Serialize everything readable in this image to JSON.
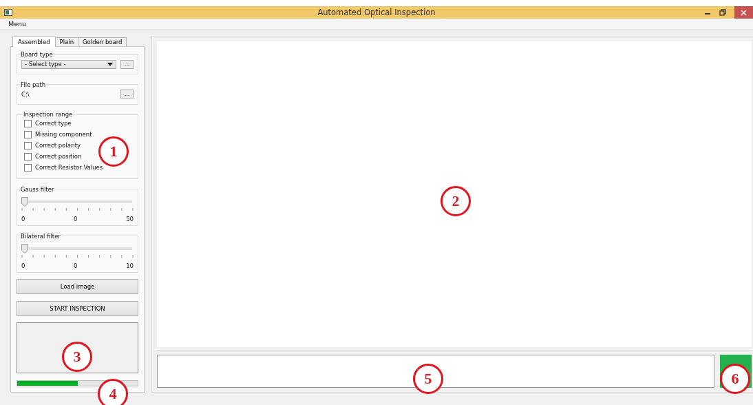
{
  "window": {
    "title": "Automated Optical Inspection"
  },
  "menu": [
    "Menu"
  ],
  "tabs": [
    {
      "label": "Assembled",
      "selected": true
    },
    {
      "label": "Plain",
      "selected": false
    },
    {
      "label": "Golden board",
      "selected": false
    }
  ],
  "board_type": {
    "title": "Board type",
    "value": "- Select type -",
    "browse": "..."
  },
  "file_path": {
    "title": "File path",
    "value": "C:\\",
    "browse": "..."
  },
  "inspection_range": {
    "title": "Inspection range",
    "options": [
      {
        "label": "Correct type",
        "checked": false
      },
      {
        "label": "Missing component",
        "checked": false
      },
      {
        "label": "Correct polarity",
        "checked": false
      },
      {
        "label": "Correct position",
        "checked": false
      },
      {
        "label": "Correct Resistor Values",
        "checked": false
      }
    ]
  },
  "filters": [
    {
      "title": "Gauss filter",
      "level": 0,
      "min": "0",
      "value": "0",
      "max": "50"
    },
    {
      "title": "Bilateral filter",
      "level": 0,
      "min": "0",
      "value": "0",
      "max": "10"
    }
  ],
  "buttons": [
    "Load image",
    "START INSPECTION"
  ],
  "progress": {
    "level": 0.5
  },
  "status_indicator": {
    "color": "#22b14c"
  },
  "annotations": [
    {
      "label": "1"
    },
    {
      "label": "2"
    },
    {
      "label": "3"
    },
    {
      "label": "4"
    },
    {
      "label": "5"
    },
    {
      "label": "6"
    }
  ]
}
